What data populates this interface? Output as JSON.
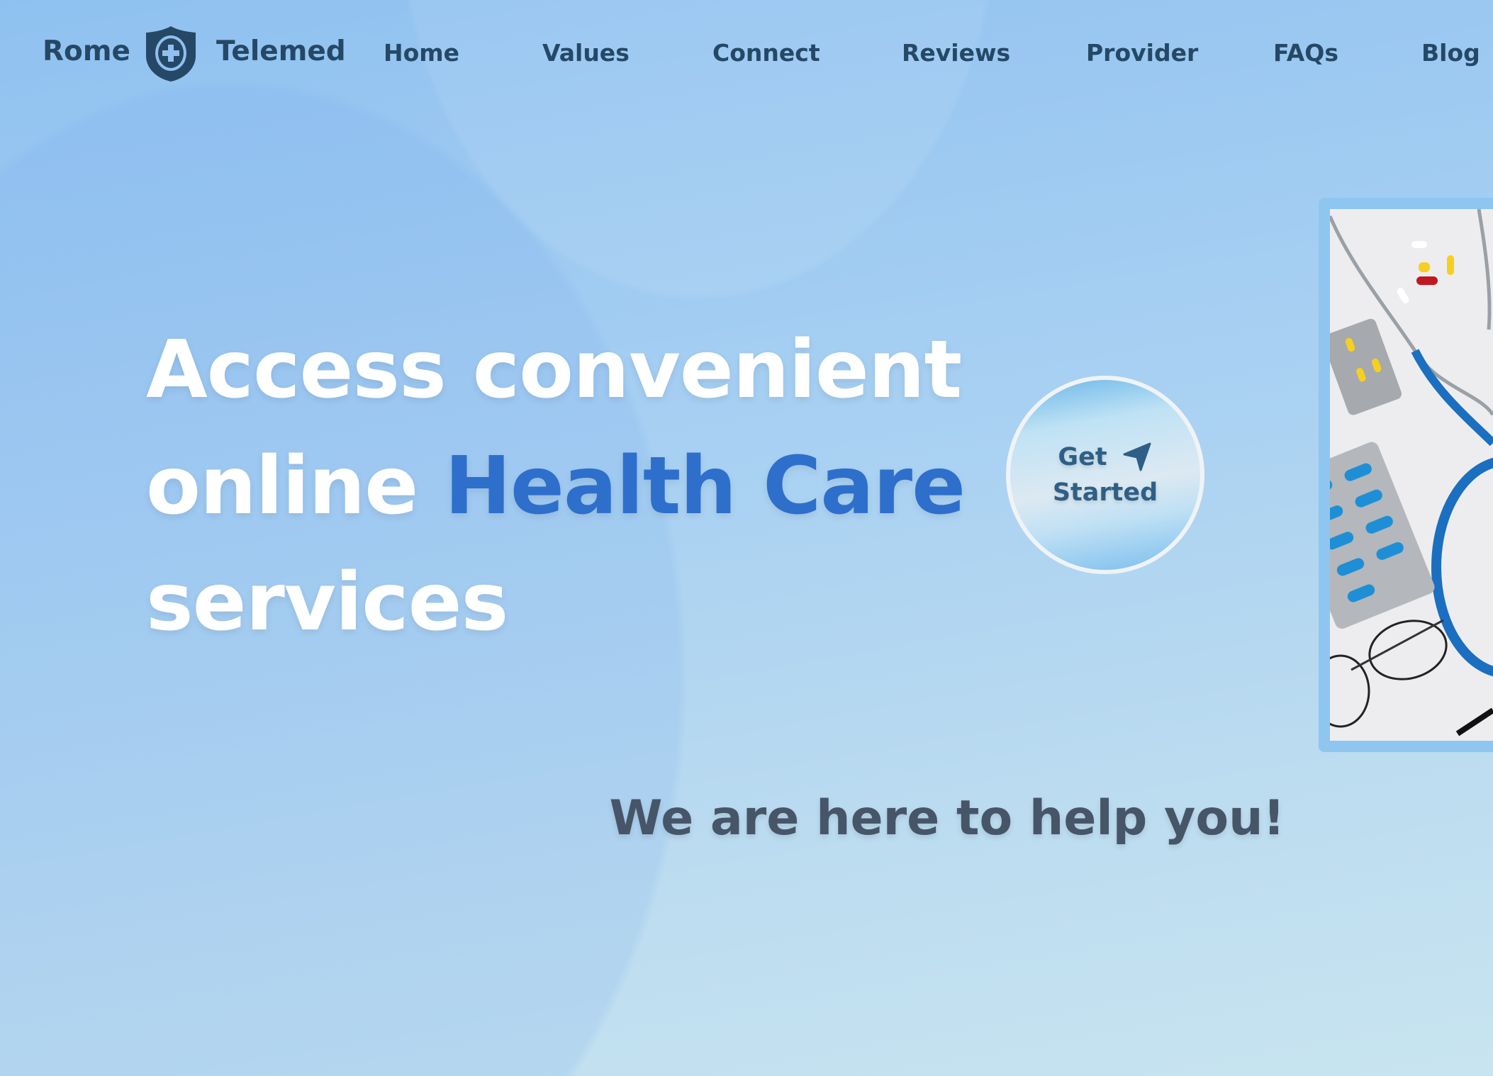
{
  "brand": {
    "left": "Rome",
    "right": "Telemed",
    "logo_icon": "shield-plus-icon"
  },
  "nav": {
    "items": [
      {
        "label": "Home"
      },
      {
        "label": "Values"
      },
      {
        "label": "Connect"
      },
      {
        "label": "Reviews"
      },
      {
        "label": "Provider"
      },
      {
        "label": "FAQs"
      },
      {
        "label": "Blog"
      }
    ]
  },
  "hero": {
    "line1": "Access convenient",
    "line2_prefix": "online ",
    "line2_highlight": "Health Care",
    "line3": "services",
    "highlight_color": "#2e6fcb"
  },
  "cta": {
    "line1": "Get",
    "line2": "Started",
    "icon": "navigation-arrow-icon"
  },
  "tagline": "We are here to help you!"
}
